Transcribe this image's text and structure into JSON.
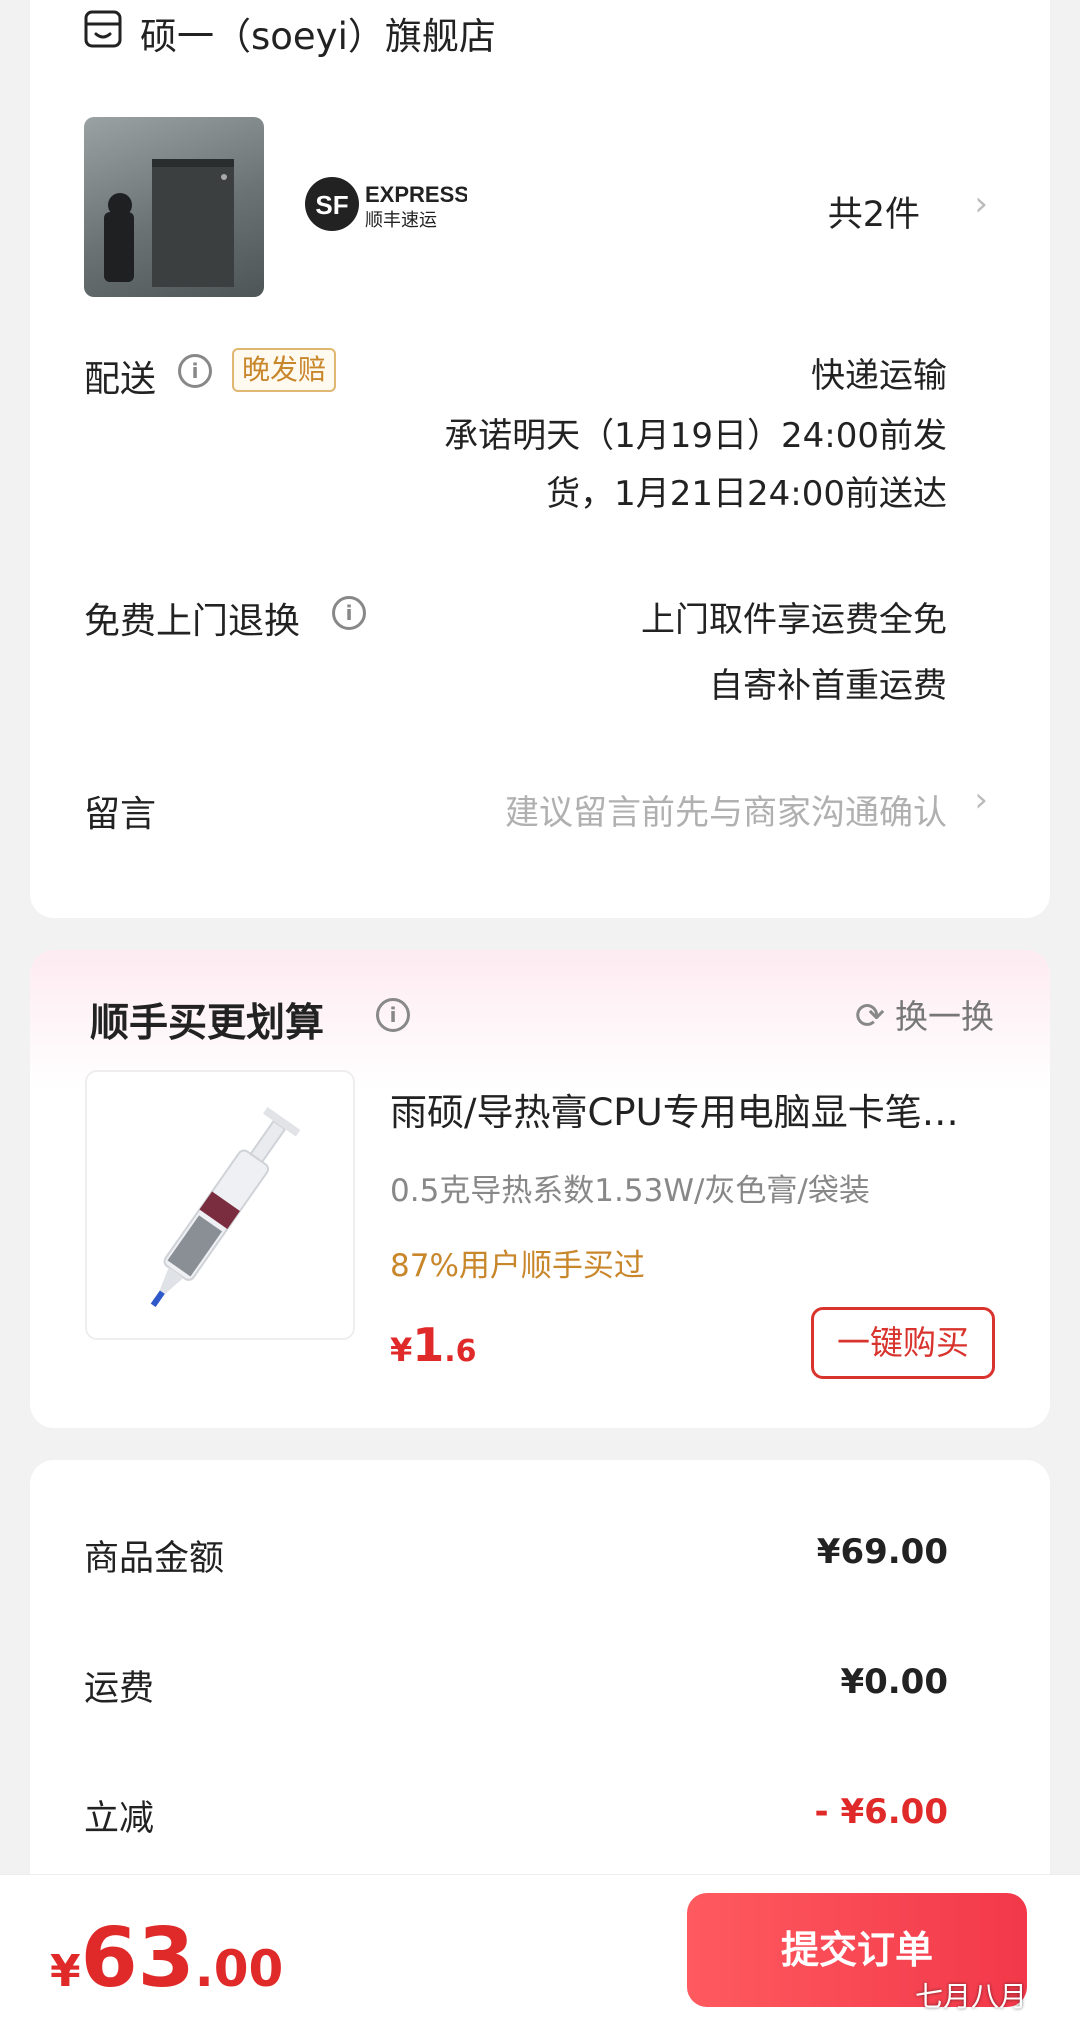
{
  "store": {
    "name": "硕一（soeyi）旗舰店",
    "icon": "store-icon"
  },
  "shipment": {
    "courier_logo_text_top": "EXPRESS",
    "courier_logo_text_bottom": "顺丰速运",
    "courier_logo_mark": "SF",
    "item_count": "共2件"
  },
  "delivery": {
    "label": "配送",
    "badge": "晚发赔",
    "method": "快递运输",
    "promise_line1": "承诺明天（1月19日）24:00前发",
    "promise_line2": "货，1月21日24:00前送达"
  },
  "returns": {
    "label": "免费上门退换",
    "line1": "上门取件享运费全免",
    "line2": "自寄补首重运费"
  },
  "message": {
    "label": "留言",
    "placeholder": "建议留言前先与商家沟通确认"
  },
  "recommend": {
    "title": "顺手买更划算",
    "refresh_label": "换一换",
    "product_name": "雨硕/导热膏CPU专用电脑显卡笔…",
    "spec": "0.5克导热系数1.53W/灰色膏/袋装",
    "bought_pct": "87%用户顺手买过",
    "price_symbol": "¥",
    "price_int": "1",
    "price_dec": ".6",
    "buy_label": "一键购买"
  },
  "summary": {
    "rows": [
      {
        "label": "商品金额",
        "value": "¥69.00"
      },
      {
        "label": "运费",
        "value": "¥0.00"
      },
      {
        "label": "立减",
        "value": "- ¥6.00"
      }
    ]
  },
  "footer": {
    "total_symbol": "¥",
    "total_int": "63",
    "total_dec": ".00",
    "submit_label": "提交订单",
    "watermark": "七月八月"
  },
  "colors": {
    "accent_red": "#e02a2a",
    "badge_gold": "#c9872c",
    "submit_gradient_start": "#ff5a5f",
    "submit_gradient_end": "#f2384a"
  }
}
